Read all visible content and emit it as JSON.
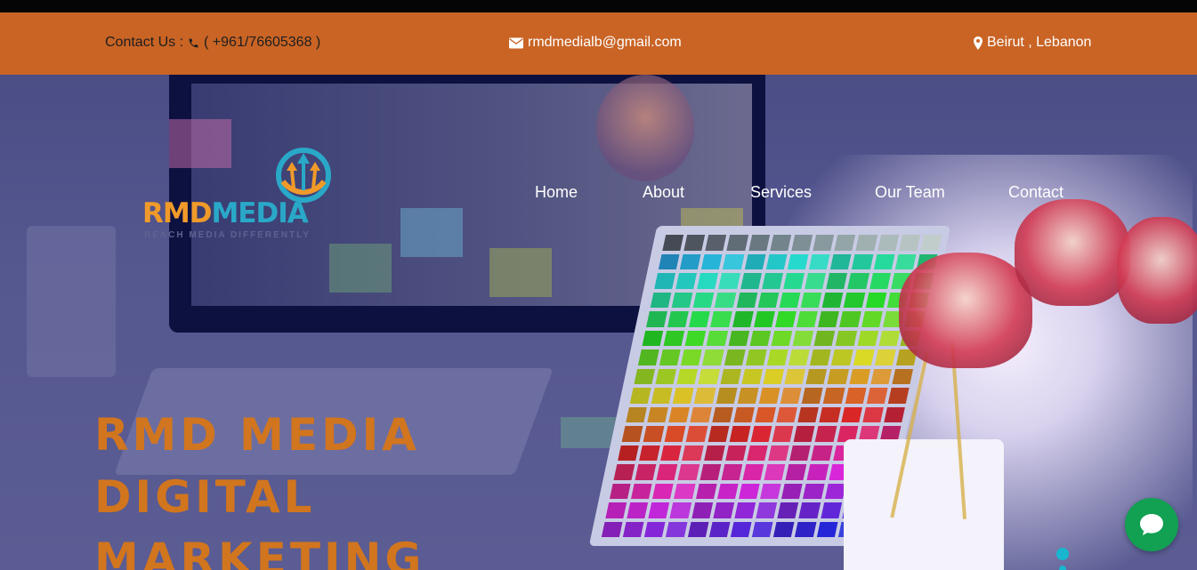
{
  "contact_bar": {
    "phone_prefix": "Contact Us :",
    "phone": "( +961/76605368 )",
    "email": "rmdmedialb@gmail.com",
    "location": "Beirut , Lebanon",
    "background_color": "#c96425"
  },
  "logo": {
    "word_part1": "RMD",
    "word_part2": "MEDIA",
    "tagline": "REACH MEDIA DIFFERENTLY"
  },
  "nav": {
    "items": [
      {
        "label": "Home"
      },
      {
        "label": "About"
      },
      {
        "label": "Services"
      },
      {
        "label": "Our Team"
      },
      {
        "label": "Contact"
      }
    ]
  },
  "hero": {
    "title_lines": [
      "RMD MEDIA",
      "DIGITAL",
      "MARKETING"
    ],
    "title_color": "#d1751e"
  },
  "chat": {
    "icon": "chat-bubble-icon",
    "color": "#12a052"
  },
  "slider": {
    "dot_color": "#19b6d0"
  }
}
